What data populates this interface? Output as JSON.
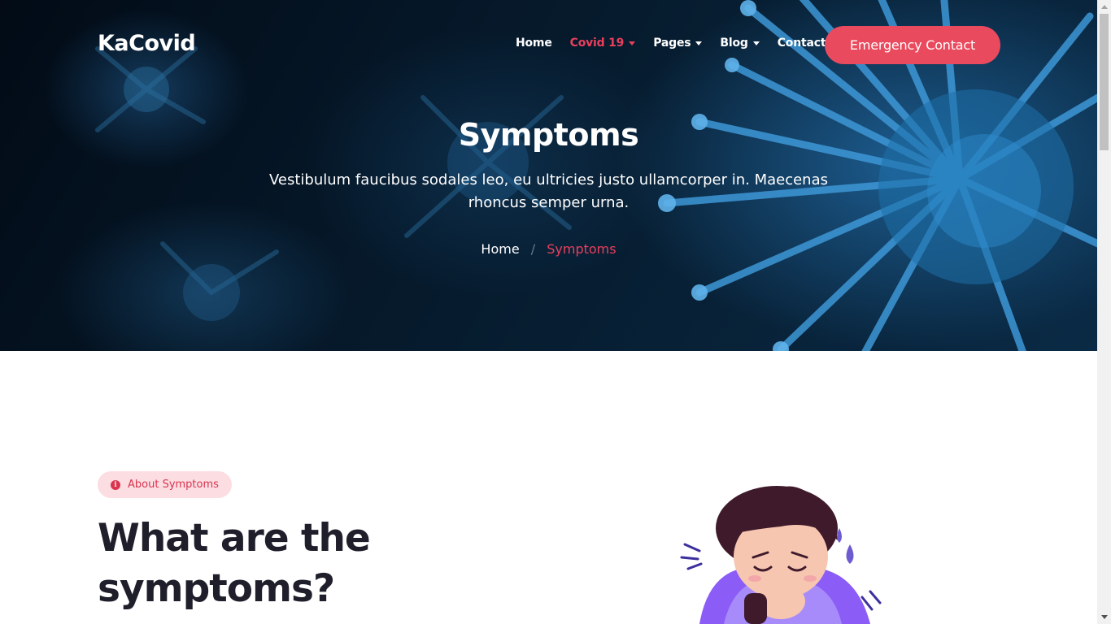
{
  "header": {
    "logo": "KaCovid",
    "nav": [
      {
        "label": "Home",
        "dropdown": false,
        "active": false
      },
      {
        "label": "Covid 19",
        "dropdown": true,
        "active": true
      },
      {
        "label": "Pages",
        "dropdown": true,
        "active": false
      },
      {
        "label": "Blog",
        "dropdown": true,
        "active": false
      },
      {
        "label": "Contact",
        "dropdown": false,
        "active": false
      }
    ],
    "cta_label": "Emergency Contact"
  },
  "hero": {
    "title": "Symptoms",
    "subtitle": "Vestibulum faucibus sodales leo, eu ultricies justo ullamcorper in. Maecenas rhoncus semper urna.",
    "background": "virus-image",
    "breadcrumb": {
      "home": "Home",
      "separator": "/",
      "current": "Symptoms"
    }
  },
  "about": {
    "badge_label": "About Symptoms",
    "badge_icon": "info-circle-icon",
    "heading": "What are the symptoms?",
    "illustration": "sick-boy-coughing-illustration"
  },
  "colors": {
    "accent": "#ea4a5d",
    "accent_text": "#ea3f5d",
    "badge_bg": "#fbdde2",
    "heading": "#1f1f2b",
    "hero_dark": "#061a2c"
  }
}
